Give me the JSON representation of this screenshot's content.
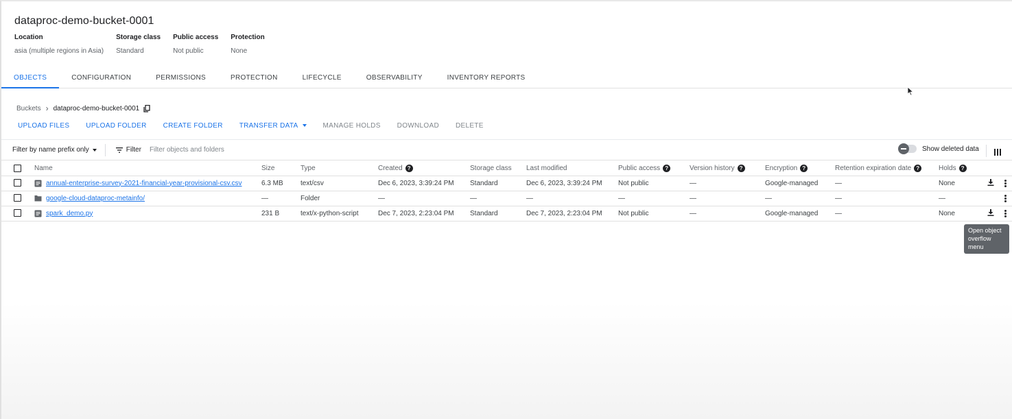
{
  "bucket": {
    "title": "dataproc-demo-bucket-0001",
    "meta": [
      {
        "label": "Location",
        "value": "asia (multiple regions in Asia)"
      },
      {
        "label": "Storage class",
        "value": "Standard"
      },
      {
        "label": "Public access",
        "value": "Not public"
      },
      {
        "label": "Protection",
        "value": "None"
      }
    ]
  },
  "tabs": [
    "OBJECTS",
    "CONFIGURATION",
    "PERMISSIONS",
    "PROTECTION",
    "LIFECYCLE",
    "OBSERVABILITY",
    "INVENTORY REPORTS"
  ],
  "breadcrumb": {
    "root": "Buckets",
    "current": "dataproc-demo-bucket-0001"
  },
  "actions": {
    "upload_files": "UPLOAD FILES",
    "upload_folder": "UPLOAD FOLDER",
    "create_folder": "CREATE FOLDER",
    "transfer_data": "TRANSFER DATA",
    "manage_holds": "MANAGE HOLDS",
    "download": "DOWNLOAD",
    "delete": "DELETE"
  },
  "filter": {
    "mode": "Filter by name prefix only",
    "label": "Filter",
    "placeholder": "Filter objects and folders",
    "show_deleted": "Show deleted data"
  },
  "table": {
    "headers": {
      "name": "Name",
      "size": "Size",
      "type": "Type",
      "created": "Created",
      "storage_class": "Storage class",
      "last_modified": "Last modified",
      "public_access": "Public access",
      "version_history": "Version history",
      "encryption": "Encryption",
      "retention": "Retention expiration date",
      "holds": "Holds"
    },
    "rows": [
      {
        "name": "annual-enterprise-survey-2021-financial-year-provisional-csv.csv",
        "icon": "file-icon",
        "size": "6.3 MB",
        "type": "text/csv",
        "created": "Dec 6, 2023, 3:39:24 PM",
        "storage_class": "Standard",
        "last_modified": "Dec 6, 2023, 3:39:24 PM",
        "public_access": "Not public",
        "version_history": "—",
        "encryption": "Google-managed",
        "retention": "—",
        "holds": "None"
      },
      {
        "name": "google-cloud-dataproc-metainfo/",
        "icon": "folder-icon",
        "size": "—",
        "type": "Folder",
        "created": "—",
        "storage_class": "—",
        "last_modified": "—",
        "public_access": "—",
        "version_history": "—",
        "encryption": "—",
        "retention": "—",
        "holds": "—"
      },
      {
        "name": "spark_demo.py",
        "icon": "file-icon",
        "size": "231 B",
        "type": "text/x-python-script",
        "created": "Dec 7, 2023, 2:23:04 PM",
        "storage_class": "Standard",
        "last_modified": "Dec 7, 2023, 2:23:04 PM",
        "public_access": "Not public",
        "version_history": "—",
        "encryption": "Google-managed",
        "retention": "—",
        "holds": "None"
      }
    ]
  },
  "tooltip": "Open object overflow menu"
}
